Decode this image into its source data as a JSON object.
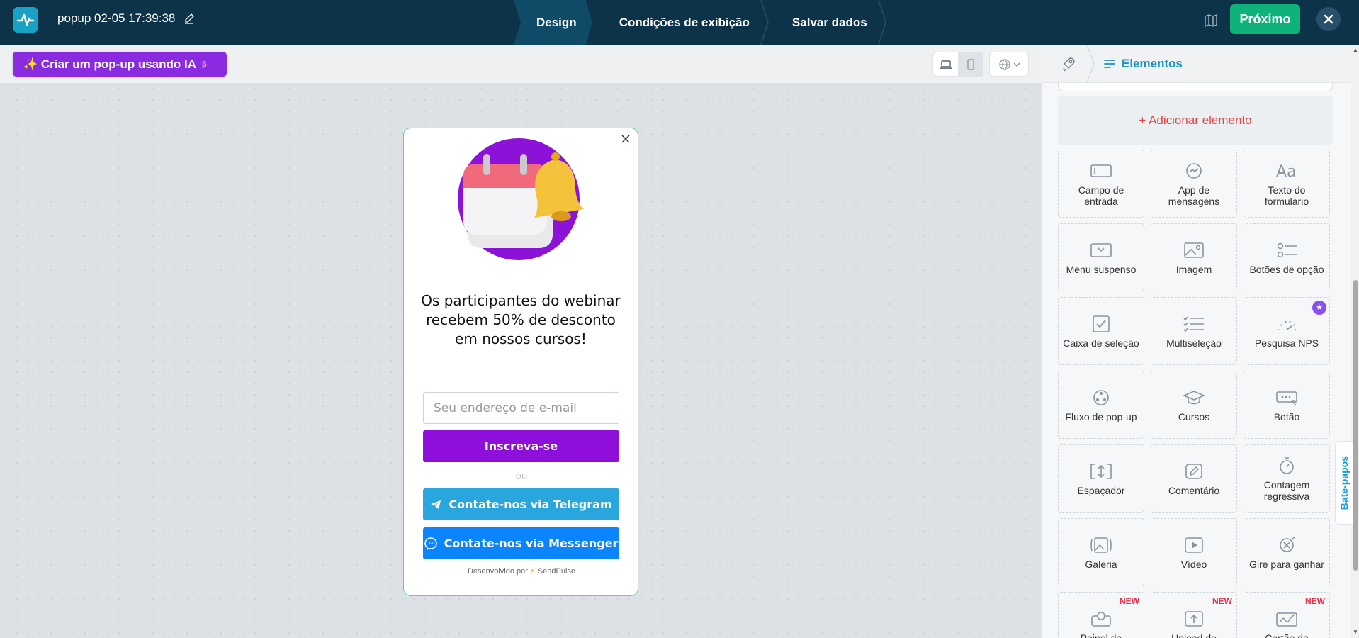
{
  "header": {
    "title": "popup 02-05 17:39:38",
    "steps": [
      "Design",
      "Condições de exibição",
      "Salvar dados"
    ],
    "next_label": "Próximo"
  },
  "toolbar": {
    "ai_label": "✨ Criar um pop-up usando IA",
    "ai_sup": "β"
  },
  "popup": {
    "headline": "Os participantes do webinar recebem 50% de desconto em nossos cursos!",
    "email_placeholder": "Seu endereço de e-mail",
    "subscribe_label": "Inscreva-se",
    "or_label": "ou",
    "telegram_label": "Contate-nos via Telegram",
    "messenger_label": "Contate-nos via Messenger",
    "powered_prefix": "Desenvolvido por",
    "powered_brand": "SendPulse"
  },
  "panel": {
    "tab_label": "Elementos",
    "add_label": "+ Adicionar elemento",
    "tiles": [
      {
        "label": "Campo de entrada",
        "icon": "input-field-icon"
      },
      {
        "label": "App de mensagens",
        "icon": "messenger-app-icon"
      },
      {
        "label": "Texto do formulário",
        "icon": "text-icon"
      },
      {
        "label": "Menu suspenso",
        "icon": "dropdown-icon"
      },
      {
        "label": "Imagem",
        "icon": "image-icon"
      },
      {
        "label": "Botões de opção",
        "icon": "radio-icon"
      },
      {
        "label": "Caixa de seleção",
        "icon": "checkbox-icon"
      },
      {
        "label": "Multiseleção",
        "icon": "multiselect-icon"
      },
      {
        "label": "Pesquisa NPS",
        "icon": "nps-icon"
      },
      {
        "label": "Fluxo de pop-up",
        "icon": "flow-icon"
      },
      {
        "label": "Cursos",
        "icon": "graduation-cap-icon"
      },
      {
        "label": "Botão",
        "icon": "button-icon"
      },
      {
        "label": "Espaçador",
        "icon": "spacer-icon"
      },
      {
        "label": "Comentário",
        "icon": "comment-icon"
      },
      {
        "label": "Contagem regressiva",
        "icon": "timer-icon"
      },
      {
        "label": "Galeria",
        "icon": "gallery-icon"
      },
      {
        "label": "Vídeo",
        "icon": "video-icon"
      },
      {
        "label": "Gire para ganhar",
        "icon": "wheel-icon"
      },
      {
        "label": "Painel de",
        "icon": "panel-icon",
        "badge": "NEW"
      },
      {
        "label": "Upload de",
        "icon": "upload-icon",
        "badge": "NEW"
      },
      {
        "label": "Cartão de",
        "icon": "card-icon",
        "badge": "NEW"
      }
    ]
  },
  "chat_tab_label": "Bate-papos",
  "colors": {
    "header_bg": "#0d3349",
    "primary_green": "#0fb37a",
    "ai_purple": "#8a2be2",
    "subscribe_purple": "#8e0fd9",
    "telegram_blue": "#2aa6df",
    "messenger_blue": "#0b84ff",
    "accent_blue": "#1a91c4",
    "add_red": "#e04646"
  }
}
